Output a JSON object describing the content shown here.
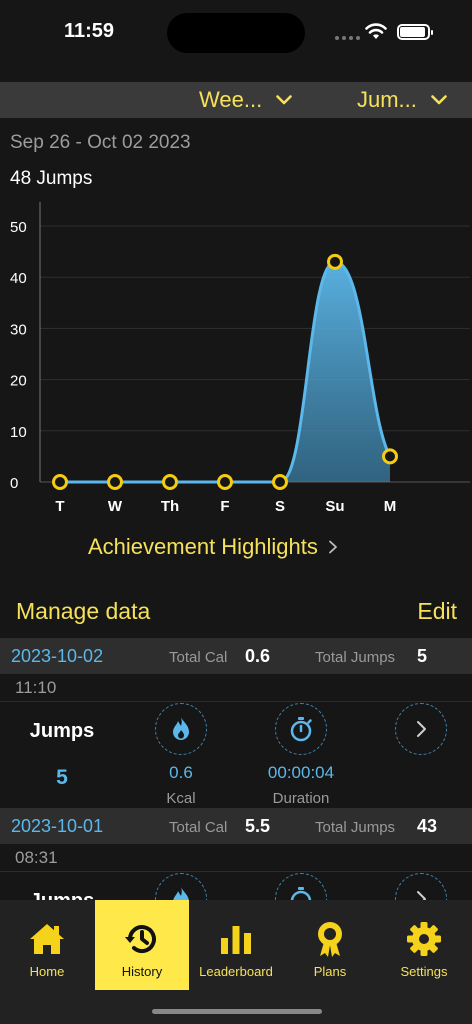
{
  "status": {
    "time": "11:59"
  },
  "filters": {
    "period": "Wee...",
    "metric": "Jum..."
  },
  "summary": {
    "date_range": "Sep 26 - Oct 02 2023",
    "total": "48 Jumps"
  },
  "chart_data": {
    "type": "area",
    "categories": [
      "T",
      "W",
      "Th",
      "F",
      "S",
      "Su",
      "M"
    ],
    "series": [
      {
        "values": [
          0,
          0,
          0,
          0,
          0,
          43,
          5
        ]
      }
    ],
    "yticks": [
      0,
      10,
      20,
      30,
      40,
      50
    ],
    "ylim": [
      0,
      50
    ],
    "grid": true,
    "colors": {
      "fill": "#3d84ad",
      "stroke": "#5cb8ea",
      "marker": "#f5cc10"
    }
  },
  "achievements": {
    "label": "Achievement Highlights"
  },
  "manage": {
    "title": "Manage data",
    "edit": "Edit"
  },
  "entries": [
    {
      "date": "2023-10-02",
      "total_cal_label": "Total Cal",
      "total_cal": "0.6",
      "total_jumps_label": "Total Jumps",
      "total_jumps": "5",
      "time": "11:10",
      "activity": "Jumps",
      "count": "5",
      "kcal": "0.6",
      "kcal_label": "Kcal",
      "duration": "00:00:04",
      "duration_label": "Duration"
    },
    {
      "date": "2023-10-01",
      "total_cal_label": "Total Cal",
      "total_cal": "5.5",
      "total_jumps_label": "Total Jumps",
      "total_jumps": "43",
      "time": "08:31",
      "activity": "Jumps"
    }
  ],
  "tabs": [
    {
      "label": "Home",
      "icon": "home-icon"
    },
    {
      "label": "History",
      "icon": "history-icon",
      "active": true
    },
    {
      "label": "Leaderboard",
      "icon": "leaderboard-icon"
    },
    {
      "label": "Plans",
      "icon": "ribbon-icon"
    },
    {
      "label": "Settings",
      "icon": "gear-icon"
    }
  ],
  "colors": {
    "accent": "#f5e15a",
    "active_tab": "#fee84a",
    "blue": "#5cb8ea",
    "background": "#161616"
  }
}
